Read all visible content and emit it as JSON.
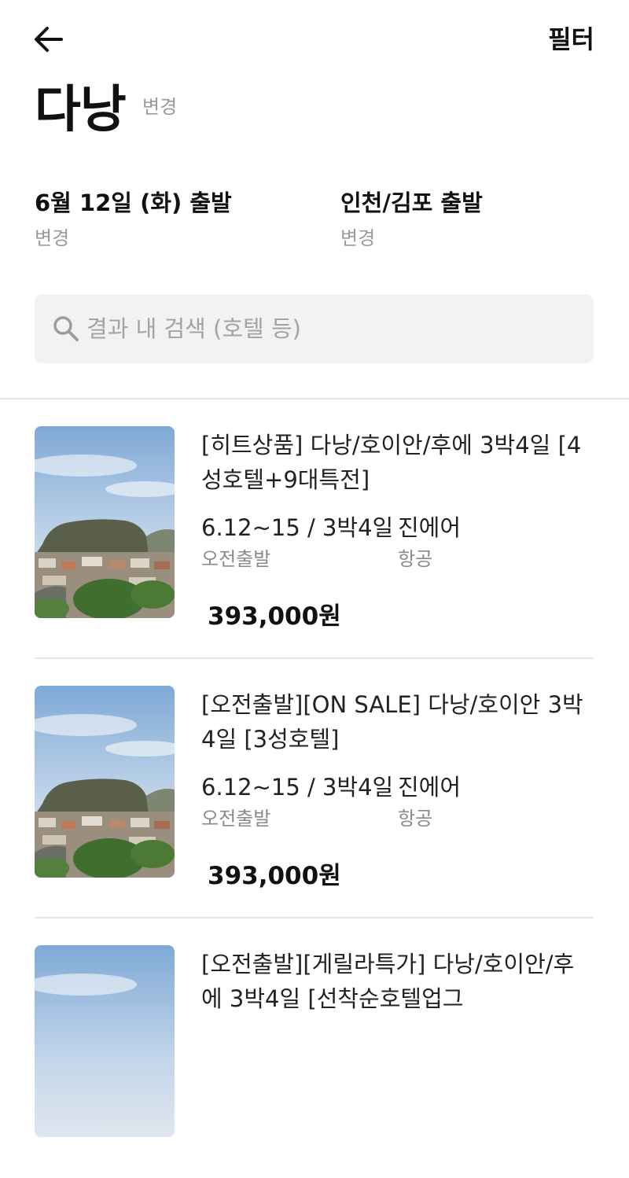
{
  "header": {
    "filter_label": "필터"
  },
  "destination": {
    "city": "다낭",
    "change_label": "변경"
  },
  "conditions": {
    "date": {
      "title": "6월 12일 (화) 출발",
      "change_label": "변경"
    },
    "departure": {
      "title": "인천/김포 출발",
      "change_label": "변경"
    }
  },
  "search": {
    "placeholder": "결과 내 검색 (호텔 등)",
    "value": ""
  },
  "results": [
    {
      "title": "[히트상품] 다낭/호이안/후에 3박4일 [4성호텔+9대특전]",
      "dates": "6.12~15 / 3박4일",
      "dates_sub": "오전출발",
      "airline": "진에어",
      "airline_sub": "항공",
      "price": "393,000원"
    },
    {
      "title": "[오전출발][ON SALE] 다낭/호이안 3박4일 [3성호텔]",
      "dates": "6.12~15 / 3박4일",
      "dates_sub": "오전출발",
      "airline": "진에어",
      "airline_sub": "항공",
      "price": "393,000원"
    },
    {
      "title": "[오전출발][게릴라특가] 다낭/호이안/후에 3박4일 [선착순호텔업그",
      "dates": "",
      "dates_sub": "",
      "airline": "",
      "airline_sub": "",
      "price": ""
    }
  ],
  "colors": {
    "text_primary": "#111111",
    "text_secondary": "#8a8a8a",
    "search_bg": "#f2f2f2",
    "divider": "#e6e6e6"
  }
}
